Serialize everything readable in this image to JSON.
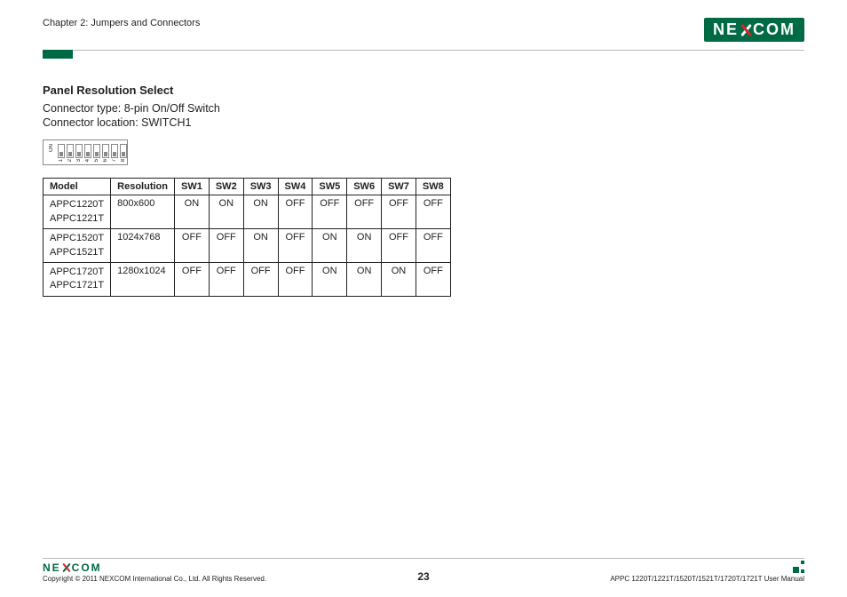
{
  "header": {
    "chapter": "Chapter 2: Jumpers and Connectors",
    "logo_parts": {
      "left": "NE",
      "right": "COM"
    }
  },
  "section": {
    "title": "Panel Resolution Select",
    "connector_type": "Connector type: 8-pin On/Off Switch",
    "connector_location": "Connector location: SWITCH1"
  },
  "dip": {
    "on_label": "ON",
    "pins": [
      "1",
      "2",
      "3",
      "4",
      "5",
      "6",
      "7",
      "8"
    ]
  },
  "table": {
    "headers": [
      "Model",
      "Resolution",
      "SW1",
      "SW2",
      "SW3",
      "SW4",
      "SW5",
      "SW6",
      "SW7",
      "SW8"
    ],
    "rows": [
      {
        "model_lines": [
          "APPC1220T",
          "APPC1221T"
        ],
        "resolution": "800x600",
        "sw": [
          "ON",
          "ON",
          "ON",
          "OFF",
          "OFF",
          "OFF",
          "OFF",
          "OFF"
        ]
      },
      {
        "model_lines": [
          "APPC1520T",
          "APPC1521T"
        ],
        "resolution": "1024x768",
        "sw": [
          "OFF",
          "OFF",
          "ON",
          "OFF",
          "ON",
          "ON",
          "OFF",
          "OFF"
        ]
      },
      {
        "model_lines": [
          "APPC1720T",
          "APPC1721T"
        ],
        "resolution": "1280x1024",
        "sw": [
          "OFF",
          "OFF",
          "OFF",
          "OFF",
          "ON",
          "ON",
          "ON",
          "OFF"
        ]
      }
    ]
  },
  "footer": {
    "copyright": "Copyright © 2011 NEXCOM International Co., Ltd. All Rights Reserved.",
    "page": "23",
    "manual": "APPC 1220T/1221T/1520T/1521T/1720T/1721T User Manual"
  }
}
